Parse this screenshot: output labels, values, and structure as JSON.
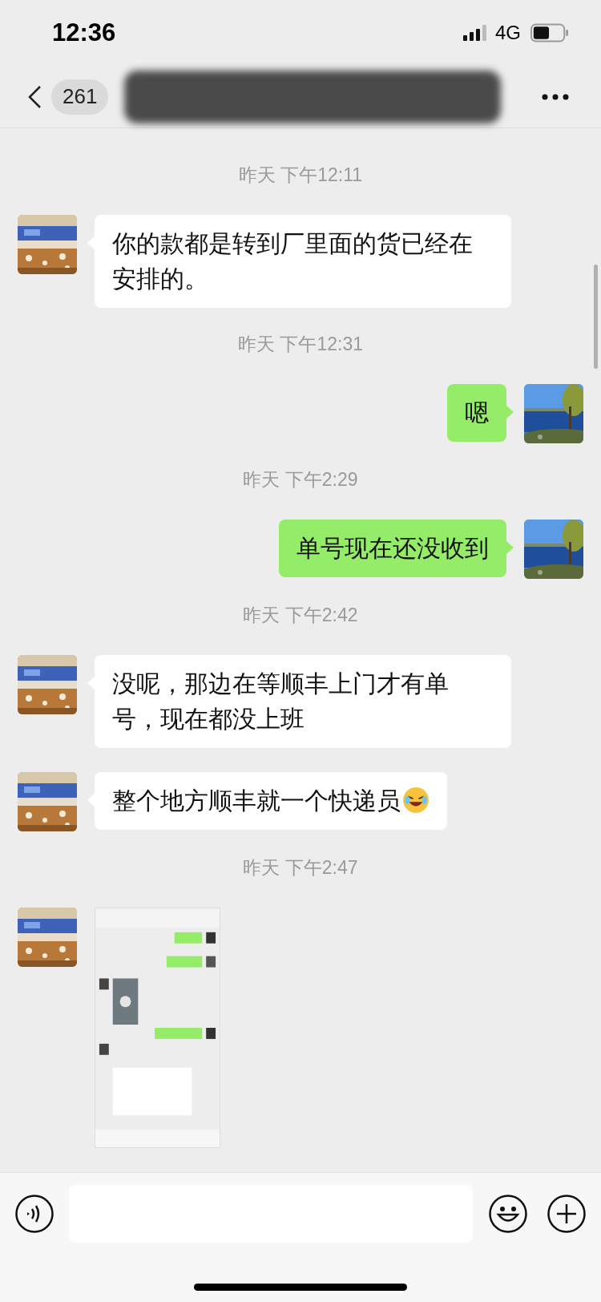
{
  "status_bar": {
    "time": "12:36",
    "network": "4G"
  },
  "nav": {
    "back_count": "261",
    "title_redacted": true
  },
  "messages": [
    {
      "kind": "time",
      "text": "昨天 下午12:11"
    },
    {
      "kind": "incoming",
      "text": "你的款都是转到厂里面的货已经在安排的。",
      "trailing_emoji": false
    },
    {
      "kind": "time",
      "text": "昨天 下午12:31"
    },
    {
      "kind": "outgoing",
      "text": "嗯",
      "trailing_emoji": false
    },
    {
      "kind": "time",
      "text": "昨天 下午2:29"
    },
    {
      "kind": "outgoing",
      "text": "单号现在还没收到",
      "trailing_emoji": false
    },
    {
      "kind": "time",
      "text": "昨天 下午2:42"
    },
    {
      "kind": "incoming",
      "text": "没呢，那边在等顺丰上门才有单号，现在都没上班",
      "trailing_emoji": false
    },
    {
      "kind": "incoming",
      "text": "整个地方顺丰就一个快递员",
      "trailing_emoji": true
    },
    {
      "kind": "time",
      "text": "昨天 下午2:47"
    },
    {
      "kind": "incoming_picture"
    }
  ]
}
